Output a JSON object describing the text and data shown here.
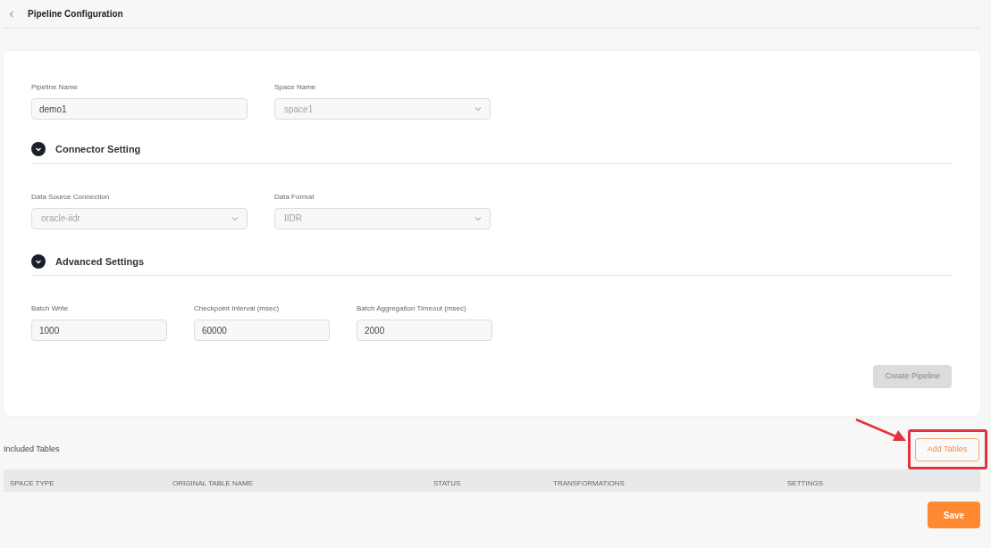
{
  "header": {
    "title": "Pipeline Configuration"
  },
  "basic_fields": [
    {
      "kind": "input",
      "label": "Pipeline Name",
      "value": "demo1",
      "disabled": false
    },
    {
      "kind": "select",
      "label": "Space Name",
      "value": "space1",
      "disabled": true
    }
  ],
  "sections": [
    {
      "title": "Connector Setting",
      "expanded": true,
      "fields": [
        {
          "kind": "select",
          "label": "Data Source Connection",
          "value": "oracle-iidr",
          "disabled": true
        },
        {
          "kind": "select",
          "label": "Data Format",
          "value": "IIDR",
          "disabled": true
        }
      ]
    },
    {
      "title": "Advanced Settings",
      "expanded": true,
      "fields": [
        {
          "kind": "input",
          "label": "Batch Write",
          "value": "1000",
          "disabled": false
        },
        {
          "kind": "input",
          "label": "Checkpoint Interval (msec)",
          "value": "60000",
          "disabled": false
        },
        {
          "kind": "input",
          "label": "Batch Aggregation Timeout (msec)",
          "value": "2000",
          "disabled": false
        }
      ]
    }
  ],
  "create_button": {
    "label": "Create Pipeline",
    "disabled": true
  },
  "included_tables": {
    "title": "Included Tables",
    "add_button": "Add Tables",
    "columns": [
      "SPACE TYPE",
      "ORIGINAL TABLE NAME",
      "STATUS",
      "TRANSFORMATIONS",
      "SETTINGS"
    ]
  },
  "save_button": "Save"
}
